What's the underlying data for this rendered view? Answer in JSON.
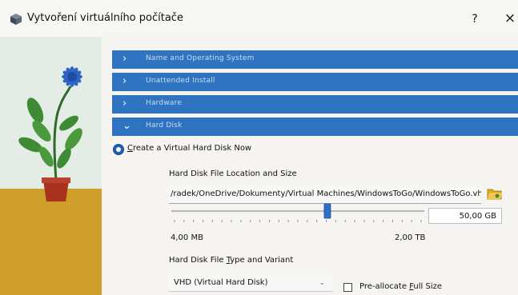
{
  "window": {
    "title": "Vytvoření virtuálního počítače",
    "help_label": "?",
    "close_label": "×"
  },
  "sections": [
    {
      "label": "Name and Operating System",
      "state": "collapsed",
      "chevron": "›"
    },
    {
      "label": "Unattended Install",
      "state": "collapsed",
      "chevron": "›"
    },
    {
      "label": "Hardware",
      "state": "collapsed",
      "chevron": "›"
    },
    {
      "label": "Hard Disk",
      "state": "expanded",
      "chevron": "⌄"
    }
  ],
  "hard_disk": {
    "option_create": {
      "label_first": "C",
      "label_rest": "reate a Virtual Hard Disk Now",
      "selected": true
    },
    "location_caption": "Hard Disk File Location and Size",
    "location_path": "/radek/OneDrive/Dokumenty/Virtual Machines/WindowsToGo/WindowsToGo.vhd",
    "size_value": "50,00 GB",
    "slider": {
      "min_label": "4,00 MB",
      "max_label": "2,00 TB",
      "level": 0.62
    },
    "type_caption_pre": "Hard Disk File ",
    "type_caption_accel": "T",
    "type_caption_post": "ype and Variant",
    "type_value": "VHD (Virtual Hard Disk)",
    "preallocate": {
      "label_pre": "Pre-allocate ",
      "label_accel": "F",
      "label_post": "ull Size",
      "checked": false
    }
  },
  "colors": {
    "section_bar": "#2f74c0",
    "radio_selected": "#1f5fb3",
    "floor": "#cf9f2c",
    "folder_icon": "#e3a81c"
  },
  "icons": {
    "app": "virtualbox-cube-icon",
    "folder": "folder-open-icon",
    "dropdown": "chevron-down-icon"
  }
}
